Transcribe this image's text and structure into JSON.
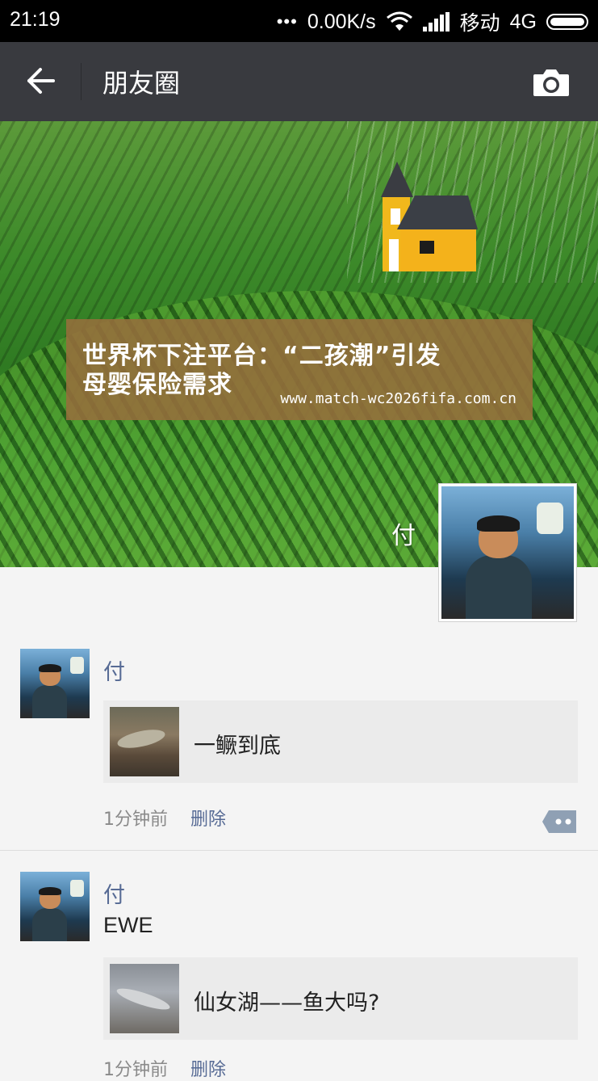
{
  "status_bar": {
    "time": "21:19",
    "dots": "•••",
    "net_speed": "0.00K/s",
    "carrier": "移动",
    "network": "4G",
    "icons": [
      "wifi-icon",
      "signal-icon",
      "battery-icon"
    ]
  },
  "nav": {
    "title": "朋友圈",
    "back_icon": "back-arrow-icon",
    "camera_icon": "camera-icon"
  },
  "cover": {
    "banner_line1": "世界杯下注平台：“二孩潮”引发",
    "banner_line2": "母婴保险需求",
    "banner_url": "www.match-wc2026fifa.com.cn",
    "user_name": "付"
  },
  "posts": [
    {
      "name": "付",
      "text": "",
      "share_title": "一鳜到底",
      "time": "1分钟前",
      "delete_label": "删除"
    },
    {
      "name": "付",
      "text": "EWE",
      "share_title": "仙女湖——鱼大吗?",
      "time": "1分钟前",
      "delete_label": "删除"
    }
  ],
  "colors": {
    "nav_bg": "#393a3f",
    "link": "#576b95",
    "share_bg": "#ebebeb",
    "page_bg": "#f4f4f4"
  }
}
